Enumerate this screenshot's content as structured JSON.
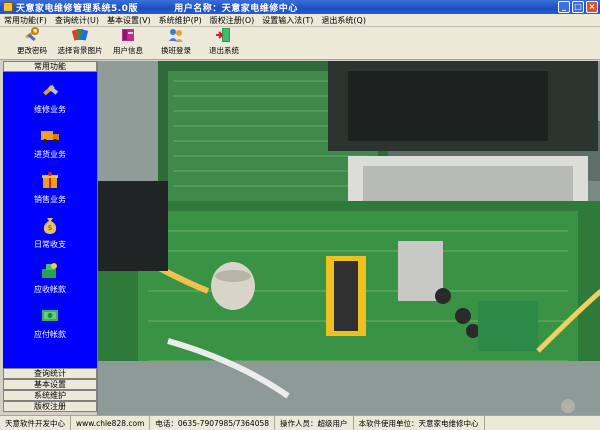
{
  "window": {
    "title": "天意家电维修管理系统5.0版          用户名称：天意家电维修中心",
    "minimize": "_",
    "maximize": "□",
    "close": "×"
  },
  "menu": [
    "常用功能(F)",
    "查询统计(U)",
    "基本设置(V)",
    "系统维护(P)",
    "版权注册(O)",
    "设置输入法(T)",
    "退出系统(Q)"
  ],
  "toolbar": [
    {
      "label": "更改密码",
      "icon": "key-tools-icon"
    },
    {
      "label": "选择背景图片",
      "icon": "palette-icon"
    },
    {
      "label": "用户信息",
      "icon": "book-icon"
    },
    {
      "label": "换班登录",
      "icon": "switch-user-icon"
    },
    {
      "label": "退出系统",
      "icon": "exit-door-icon"
    }
  ],
  "sidebar": {
    "header": "常用功能",
    "items": [
      {
        "label": "维修业务",
        "icon": "repair-icon"
      },
      {
        "label": "进货业务",
        "icon": "truck-icon"
      },
      {
        "label": "销售业务",
        "icon": "gift-box-icon"
      },
      {
        "label": "日常收支",
        "icon": "money-bag-icon"
      },
      {
        "label": "应收帐款",
        "icon": "receivable-icon"
      },
      {
        "label": "应付帐款",
        "icon": "payable-icon"
      }
    ],
    "footers": [
      "查询统计",
      "基本设置",
      "系统维护",
      "版权注册"
    ]
  },
  "status": [
    "天意软件开发中心",
    "www.chle828.com",
    "电话：0635-7907985/7364058",
    "操作人员：超级用户",
    "本软件使用单位：天意家电维修中心"
  ]
}
